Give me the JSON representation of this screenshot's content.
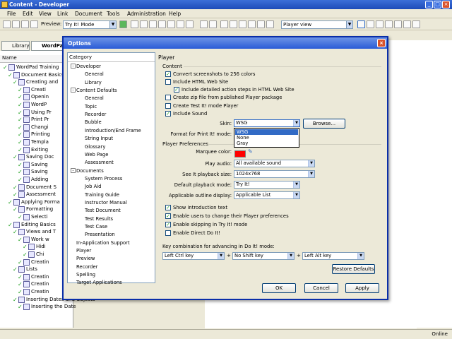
{
  "app": {
    "title": "Content - Developer",
    "status": "Online",
    "menu": [
      "File",
      "Edit",
      "View",
      "Link",
      "Document",
      "Tools",
      "Administration",
      "Help"
    ],
    "toolbar": {
      "preview_label": "Preview:",
      "preview_value": "Try It! Mode",
      "view_value": "Player view"
    },
    "tabs": {
      "library": "Library",
      "wordpad": "WordPad"
    },
    "tree_header": "Name",
    "tree": [
      {
        "label": "WordPad Training"
      },
      {
        "label": "Document Basics"
      },
      {
        "label": "Creating and"
      },
      {
        "label": "Creati"
      },
      {
        "label": "Openin"
      },
      {
        "label": "WordP"
      },
      {
        "label": "Using Pr"
      },
      {
        "label": "Print Pr"
      },
      {
        "label": "Changi"
      },
      {
        "label": "Printing"
      },
      {
        "label": "Templa"
      },
      {
        "label": "Exiting"
      },
      {
        "label": "Saving Doc"
      },
      {
        "label": "Saving"
      },
      {
        "label": "Saving"
      },
      {
        "label": "Adding"
      },
      {
        "label": "Document S"
      },
      {
        "label": "Assessment"
      },
      {
        "label": "Applying Forma"
      },
      {
        "label": "Formatting"
      },
      {
        "label": "Selecti"
      },
      {
        "label": "Editing Basics"
      },
      {
        "label": "Views and T"
      },
      {
        "label": "Work w"
      },
      {
        "label": "Hidi"
      },
      {
        "label": "Chi"
      },
      {
        "label": "Creatin"
      },
      {
        "label": "Lists"
      },
      {
        "label": "Creatin"
      },
      {
        "label": "Creatin"
      },
      {
        "label": "Creatin"
      },
      {
        "label": "Inserting Dates and Objects"
      },
      {
        "label": "Inserting the Date"
      }
    ]
  },
  "dialog": {
    "title": "Options",
    "close": "×",
    "category_header": "Category",
    "categories": [
      {
        "label": "Developer",
        "level": 0,
        "expander": "-"
      },
      {
        "label": "General",
        "level": 1
      },
      {
        "label": "Library",
        "level": 1
      },
      {
        "label": "Content Defaults",
        "level": 0,
        "expander": "-"
      },
      {
        "label": "General",
        "level": 1
      },
      {
        "label": "Topic",
        "level": 1
      },
      {
        "label": "Recorder",
        "level": 1
      },
      {
        "label": "Bubble",
        "level": 1
      },
      {
        "label": "Introduction/End Frame",
        "level": 1
      },
      {
        "label": "String Input",
        "level": 1
      },
      {
        "label": "Glossary",
        "level": 1
      },
      {
        "label": "Web Page",
        "level": 1
      },
      {
        "label": "Assessment",
        "level": 1
      },
      {
        "label": "Documents",
        "level": 0,
        "expander": "-"
      },
      {
        "label": "System Process",
        "level": 1
      },
      {
        "label": "Job Aid",
        "level": 1
      },
      {
        "label": "Training Guide",
        "level": 1
      },
      {
        "label": "Instructor Manual",
        "level": 1
      },
      {
        "label": "Test Document",
        "level": 1
      },
      {
        "label": "Test Results",
        "level": 1
      },
      {
        "label": "Test Case",
        "level": 1
      },
      {
        "label": "Presentation",
        "level": 1
      },
      {
        "label": "In-Application Support",
        "level": 0
      },
      {
        "label": "Player",
        "level": 0
      },
      {
        "label": "Preview",
        "level": 0
      },
      {
        "label": "Recorder",
        "level": 0
      },
      {
        "label": "Spelling",
        "level": 0
      },
      {
        "label": "Target Applications",
        "level": 0
      }
    ],
    "panel_title": "Player",
    "content_section": "Content",
    "content_checks": [
      {
        "label": "Convert screenshots to 256 colors",
        "checked": true
      },
      {
        "label": "Include HTML Web Site",
        "checked": false
      },
      {
        "label": "Include detailed action steps in HTML Web Site",
        "checked": true
      },
      {
        "label": "Create zip file from published Player package",
        "checked": false
      },
      {
        "label": "Create Test It! mode Player",
        "checked": false
      },
      {
        "label": "Include Sound",
        "checked": true
      }
    ],
    "skin_label": "Skin:",
    "skin_value": "WSG",
    "skin_options": [
      "WSG",
      "None",
      "Gray"
    ],
    "browse": "Browse...",
    "print_format_label": "Format for Print It! mode:",
    "prefs_section": "Player Preferences",
    "marquee_label": "Marquee color:",
    "marquee_color": "#ff0000",
    "play_audio_label": "Play audio:",
    "play_audio_value": "All available sound",
    "playback_size_label": "See It playback size:",
    "playback_size_value": "1024x768",
    "default_mode_label": "Default playback mode:",
    "default_mode_value": "Try It!",
    "outline_label": "Applicable outline display:",
    "outline_value": "Applicable List",
    "pref_checks": [
      {
        "label": "Show introduction text",
        "checked": true
      },
      {
        "label": "Enable users to change their Player preferences",
        "checked": true
      },
      {
        "label": "Enable skipping in Try It! mode",
        "checked": true
      },
      {
        "label": "Enable Direct Do It!",
        "checked": false
      }
    ],
    "keycombo_label": "Key combination for advancing in Do It! mode:",
    "key1": "Left Ctrl key",
    "key2": "No Shift key",
    "key3": "Left Alt key",
    "plus": "+",
    "restore": "Restore Defaults",
    "ok": "OK",
    "cancel": "Cancel",
    "apply": "Apply"
  }
}
